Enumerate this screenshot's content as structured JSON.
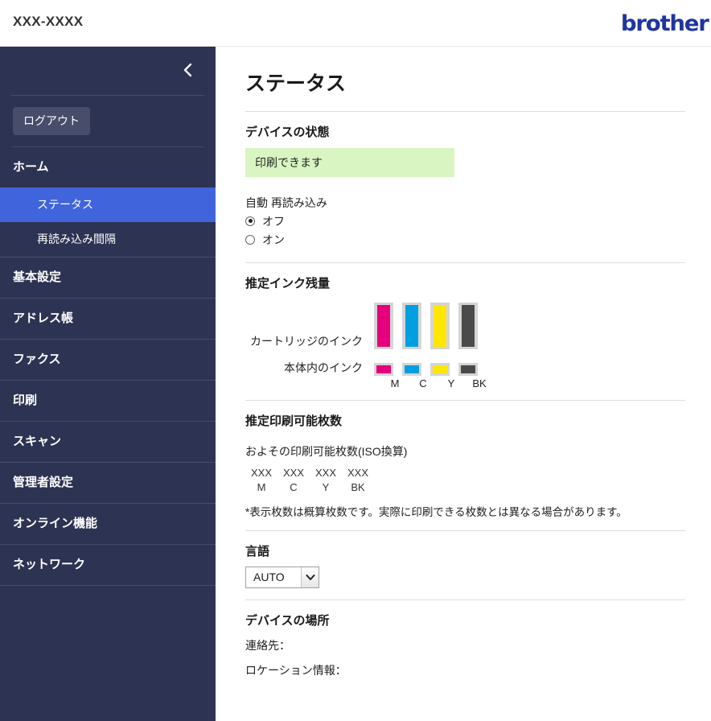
{
  "header": {
    "model": "XXX-XXXX",
    "brand": "brother"
  },
  "sidebar": {
    "collapse_icon": "chevron-left-icon",
    "logout_label": "ログアウト",
    "items": [
      {
        "label": "ホーム",
        "type": "group"
      },
      {
        "label": "ステータス",
        "type": "sub",
        "active": true
      },
      {
        "label": "再読み込み間隔",
        "type": "sub",
        "active": false
      },
      {
        "label": "基本設定",
        "type": "group"
      },
      {
        "label": "アドレス帳",
        "type": "group"
      },
      {
        "label": "ファクス",
        "type": "group"
      },
      {
        "label": "印刷",
        "type": "group"
      },
      {
        "label": "スキャン",
        "type": "group"
      },
      {
        "label": "管理者設定",
        "type": "group"
      },
      {
        "label": "オンライン機能",
        "type": "group"
      },
      {
        "label": "ネットワーク",
        "type": "group"
      }
    ]
  },
  "main": {
    "page_title": "ステータス",
    "device_status": {
      "heading": "デバイスの状態",
      "value": "印刷できます",
      "banner_color": "#d8f5c2"
    },
    "auto_refresh": {
      "label": "自動 再読み込み",
      "options": [
        {
          "label": "オフ",
          "selected": true
        },
        {
          "label": "オン",
          "selected": false
        }
      ]
    },
    "ink": {
      "heading": "推定インク残量",
      "cartridge_label": "カートリッジのインク",
      "internal_label": "本体内のインク",
      "channels": [
        {
          "key": "M",
          "color": "#e6007e",
          "cartridge_level": 100,
          "internal_level": 100
        },
        {
          "key": "C",
          "color": "#00a0e0",
          "cartridge_level": 100,
          "internal_level": 100
        },
        {
          "key": "Y",
          "color": "#ffe600",
          "cartridge_level": 100,
          "internal_level": 100
        },
        {
          "key": "BK",
          "color": "#4a4a4a",
          "cartridge_level": 100,
          "internal_level": 100
        }
      ]
    },
    "yield": {
      "heading": "推定印刷可能枚数",
      "caption": "およその印刷可能枚数(ISO換算)",
      "values": [
        "XXX",
        "XXX",
        "XXX",
        "XXX"
      ],
      "keys": [
        "M",
        "C",
        "Y",
        "BK"
      ],
      "note": "*表示枚数は概算枚数です。実際に印刷できる枚数とは異なる場合があります。"
    },
    "language": {
      "heading": "言語",
      "selected": "AUTO"
    },
    "location": {
      "heading": "デバイスの場所",
      "contact_label": "連絡先：",
      "location_label": "ロケーション情報："
    }
  },
  "colors": {
    "sidebar_bg": "#2d3352",
    "active_nav": "#4064db",
    "brand": "#1f35a0"
  }
}
